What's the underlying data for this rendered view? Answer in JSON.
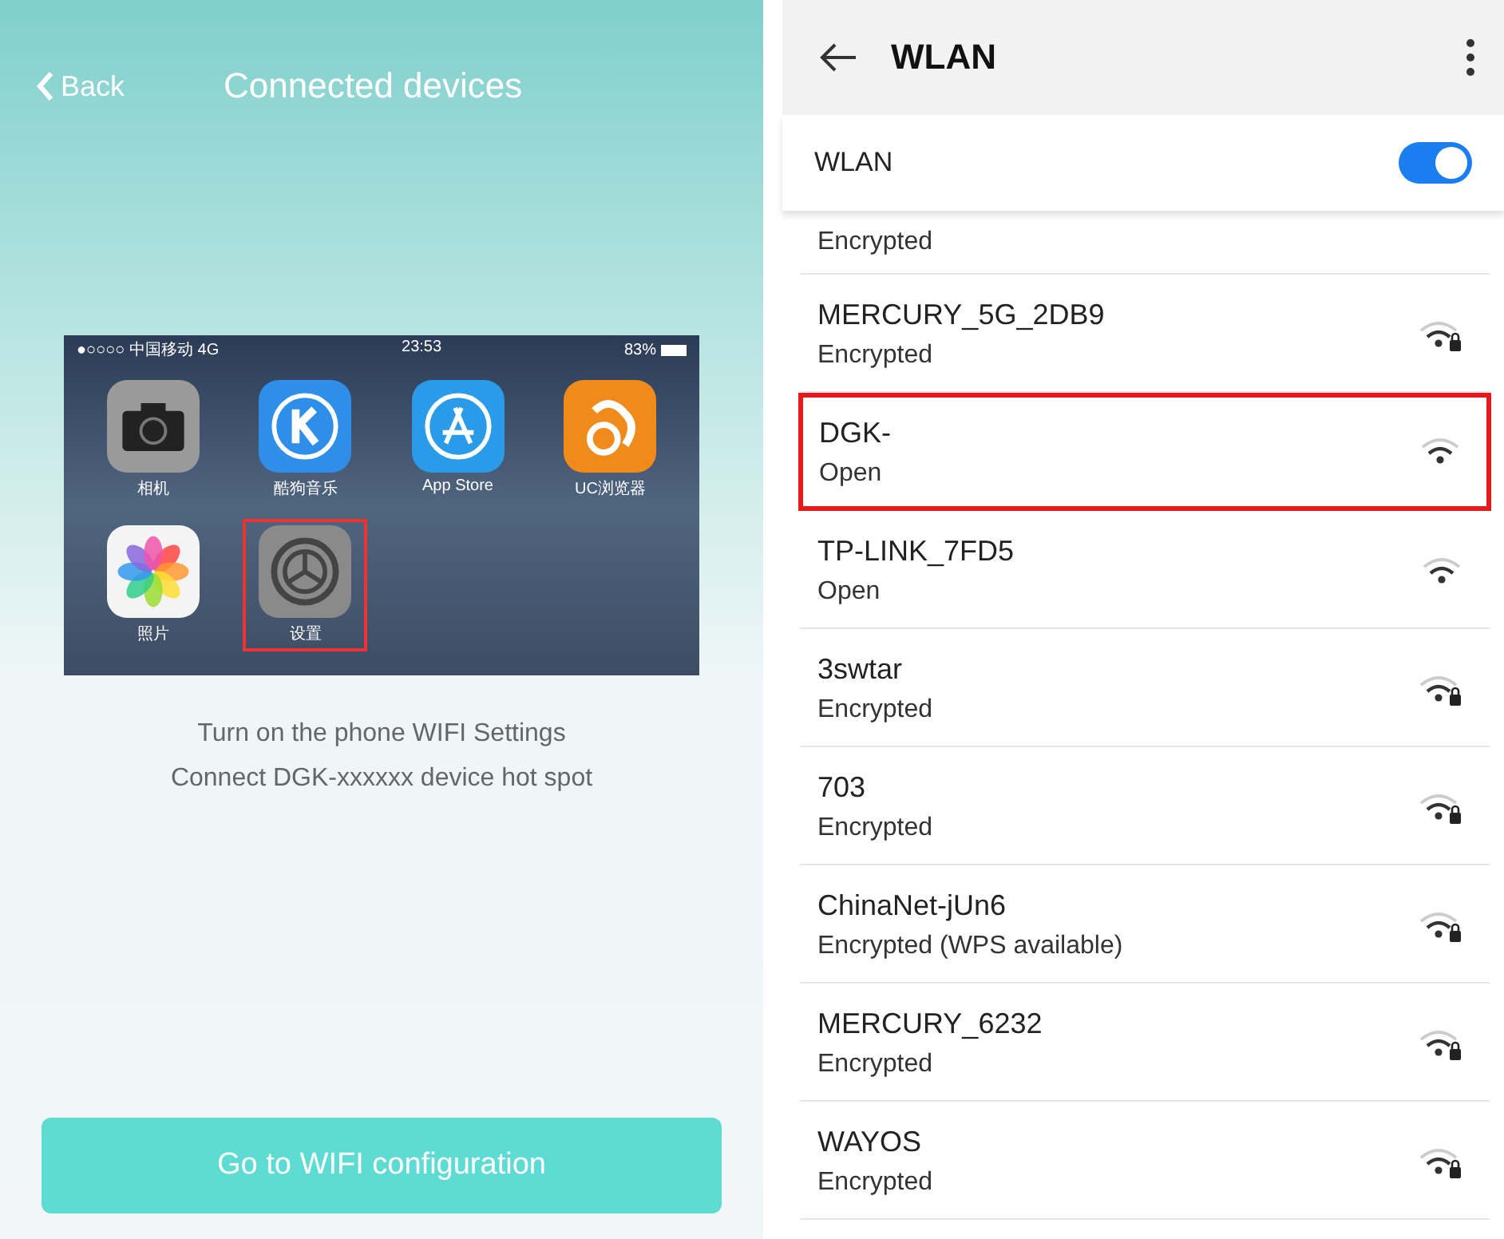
{
  "left": {
    "back": "Back",
    "title": "Connected devices",
    "phone": {
      "carrier": "●○○○○ 中国移动  4G",
      "time": "23:53",
      "battery": "83%",
      "apps": [
        {
          "kind": "camera",
          "label": "相机",
          "highlighted": false
        },
        {
          "kind": "music",
          "label": "酷狗音乐",
          "highlighted": false
        },
        {
          "kind": "store",
          "label": "App Store",
          "highlighted": false
        },
        {
          "kind": "browser",
          "label": "UC浏览器",
          "highlighted": false
        },
        {
          "kind": "photos",
          "label": "照片",
          "highlighted": false
        },
        {
          "kind": "settings",
          "label": "设置",
          "highlighted": true
        }
      ]
    },
    "instructions": [
      "Turn on the phone WIFI Settings",
      "Connect DGK-xxxxxx device hot spot"
    ],
    "button": "Go to WIFI configuration"
  },
  "right": {
    "title": "WLAN",
    "toggle": {
      "label": "WLAN",
      "on": true
    },
    "networks": [
      {
        "status": "Encrypted",
        "highlighted": false
      },
      {
        "name": "MERCURY_5G_2DB9",
        "status": "Encrypted",
        "locked": true,
        "highlighted": false
      },
      {
        "name": "DGK-",
        "status": "Open",
        "locked": false,
        "highlighted": true
      },
      {
        "name": "TP-LINK_7FD5",
        "status": "Open",
        "locked": false,
        "highlighted": false
      },
      {
        "name": "3swtar",
        "status": "Encrypted",
        "locked": true,
        "highlighted": false
      },
      {
        "name": "703",
        "status": "Encrypted",
        "locked": true,
        "highlighted": false
      },
      {
        "name": "ChinaNet-jUn6",
        "status": "Encrypted (WPS available)",
        "locked": true,
        "highlighted": false
      },
      {
        "name": "MERCURY_6232",
        "status": "Encrypted",
        "locked": true,
        "highlighted": false
      },
      {
        "name": "WAYOS",
        "status": "Encrypted",
        "locked": true,
        "highlighted": false
      }
    ]
  }
}
